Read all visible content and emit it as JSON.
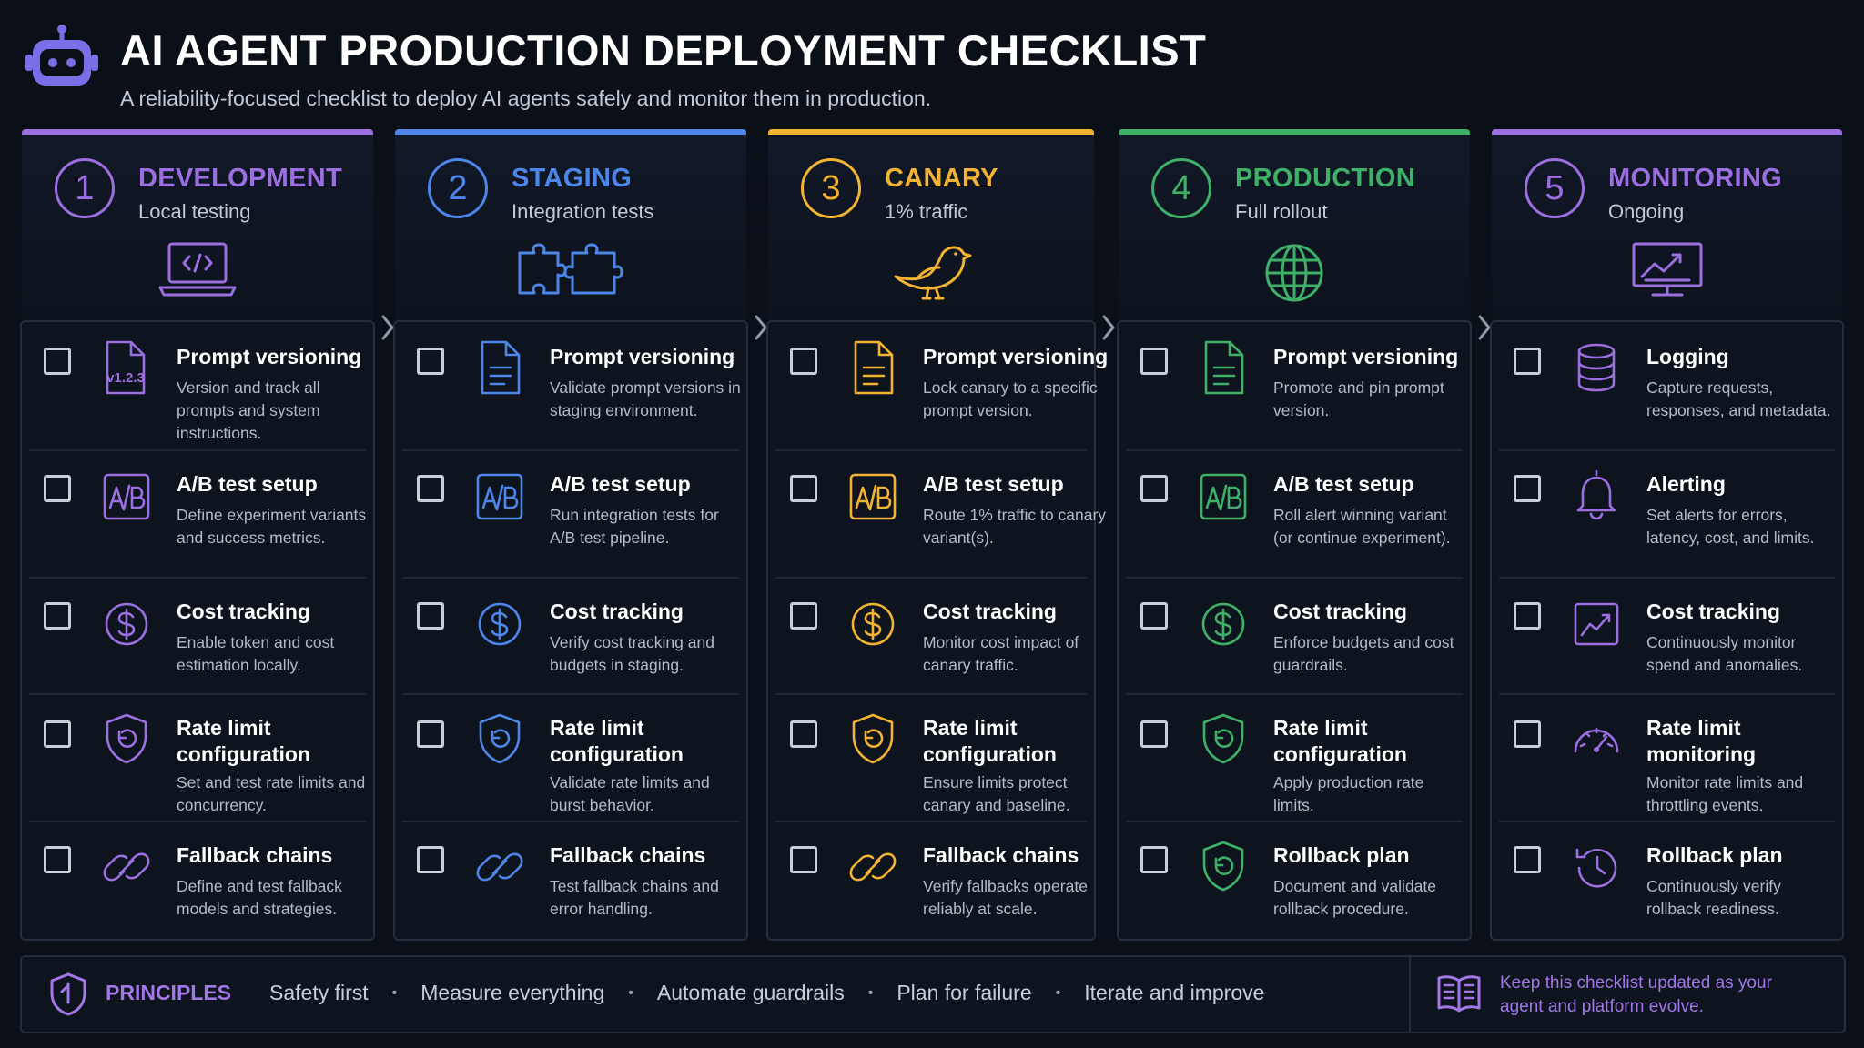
{
  "header": {
    "title": "AI AGENT PRODUCTION DEPLOYMENT CHECKLIST",
    "subtitle": "A reliability-focused checklist to deploy AI agents safely and monitor them in production.",
    "logo_icon": "robot-icon",
    "accent": "#7a6fe6"
  },
  "stages": [
    {
      "number": "1",
      "title": "DEVELOPMENT",
      "subtitle": "Local testing",
      "color": "#9b6fe0",
      "icon": "laptop-code-icon",
      "items": [
        {
          "title": "Prompt versioning",
          "desc": "Version and track all prompts and system instructions.",
          "icon": "file-version-icon",
          "badge": "v1.2.3"
        },
        {
          "title": "A/B test setup",
          "desc": "Define experiment variants and success metrics.",
          "icon": "ab-test-icon"
        },
        {
          "title": "Cost tracking",
          "desc": "Enable token and cost estimation locally.",
          "icon": "dollar-icon"
        },
        {
          "title": "Rate limit configuration",
          "desc": "Set and test rate limits and concurrency.",
          "icon": "shield-refresh-icon"
        },
        {
          "title": "Fallback chains",
          "desc": "Define and test fallback models and strategies.",
          "icon": "link-icon"
        }
      ]
    },
    {
      "number": "2",
      "title": "STAGING",
      "subtitle": "Integration tests",
      "color": "#4d86e8",
      "icon": "puzzle-icon",
      "items": [
        {
          "title": "Prompt versioning",
          "desc": "Validate prompt versions in staging environment.",
          "icon": "document-icon"
        },
        {
          "title": "A/B test setup",
          "desc": "Run integration tests for A/B test pipeline.",
          "icon": "ab-test-icon"
        },
        {
          "title": "Cost tracking",
          "desc": "Verify cost tracking and budgets in staging.",
          "icon": "dollar-icon"
        },
        {
          "title": "Rate limit configuration",
          "desc": "Validate rate limits and burst behavior.",
          "icon": "shield-refresh-icon"
        },
        {
          "title": "Fallback chains",
          "desc": "Test fallback chains and error handling.",
          "icon": "link-icon"
        }
      ]
    },
    {
      "number": "3",
      "title": "CANARY",
      "subtitle": "1% traffic",
      "color": "#f2b233",
      "icon": "bird-icon",
      "items": [
        {
          "title": "Prompt versioning",
          "desc": "Lock canary to a specific prompt version.",
          "icon": "document-icon"
        },
        {
          "title": "A/B test setup",
          "desc": "Route 1% traffic to canary variant(s).",
          "icon": "ab-test-icon"
        },
        {
          "title": "Cost tracking",
          "desc": "Monitor cost impact of canary traffic.",
          "icon": "dollar-icon"
        },
        {
          "title": "Rate limit configuration",
          "desc": "Ensure limits protect canary and baseline.",
          "icon": "shield-refresh-icon"
        },
        {
          "title": "Fallback chains",
          "desc": "Verify fallbacks operate reliably at scale.",
          "icon": "link-icon"
        }
      ]
    },
    {
      "number": "4",
      "title": "PRODUCTION",
      "subtitle": "Full rollout",
      "color": "#3fb067",
      "icon": "globe-icon",
      "items": [
        {
          "title": "Prompt versioning",
          "desc": "Promote and pin prompt version.",
          "icon": "document-icon"
        },
        {
          "title": "A/B test setup",
          "desc": "Roll alert winning variant (or continue experiment).",
          "icon": "ab-test-icon"
        },
        {
          "title": "Cost tracking",
          "desc": "Enforce budgets and cost guardrails.",
          "icon": "dollar-icon"
        },
        {
          "title": "Rate limit configuration",
          "desc": "Apply production rate limits.",
          "icon": "shield-refresh-icon"
        },
        {
          "title": "Rollback plan",
          "desc": "Document and validate rollback procedure.",
          "icon": "shield-refresh-icon"
        }
      ]
    },
    {
      "number": "5",
      "title": "MONITORING",
      "subtitle": "Ongoing",
      "color": "#9b6fe0",
      "icon": "monitor-chart-icon",
      "items": [
        {
          "title": "Logging",
          "desc": "Capture requests, responses, and metadata.",
          "icon": "database-icon"
        },
        {
          "title": "Alerting",
          "desc": "Set alerts for errors, latency, cost, and limits.",
          "icon": "bell-icon"
        },
        {
          "title": "Cost tracking",
          "desc": "Continuously monitor spend and anomalies.",
          "icon": "trend-chart-icon"
        },
        {
          "title": "Rate limit monitoring",
          "desc": "Monitor rate limits and throttling events.",
          "icon": "gauge-icon"
        },
        {
          "title": "Rollback plan",
          "desc": "Continuously verify rollback readiness.",
          "icon": "history-icon"
        }
      ]
    }
  ],
  "footer": {
    "label": "PRINCIPLES",
    "principles": [
      "Safety first",
      "Measure everything",
      "Automate guardrails",
      "Plan for failure",
      "Iterate and improve"
    ],
    "note": "Keep this checklist updated as your agent and platform evolve.",
    "accent": "#a277e6"
  }
}
